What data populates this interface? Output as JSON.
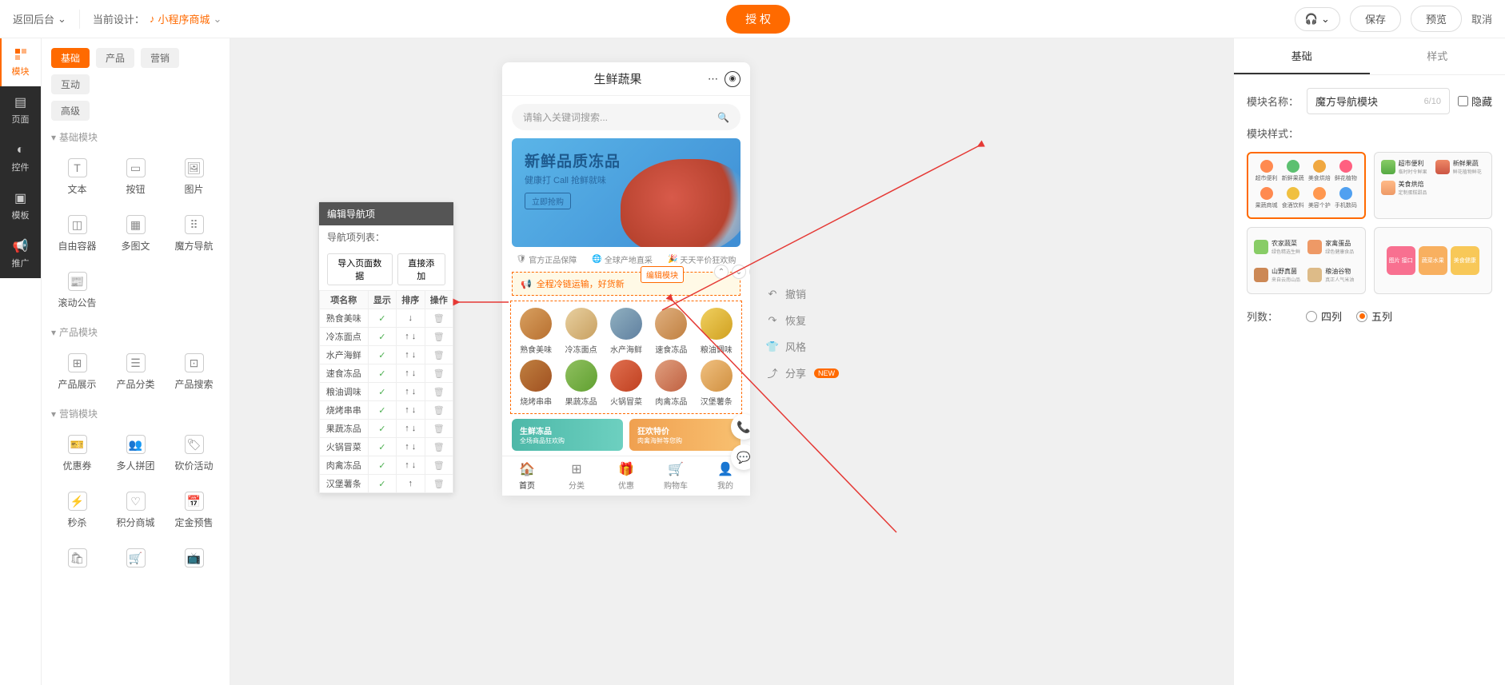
{
  "topbar": {
    "back": "返回后台",
    "current_design_label": "当前设计：",
    "current_design_name": "小程序商城",
    "auth": "授 权",
    "save": "保存",
    "preview": "预览",
    "cancel": "取消"
  },
  "nav_rail": [
    {
      "label": "模块",
      "active": true
    },
    {
      "label": "页面",
      "active": false
    },
    {
      "label": "控件",
      "active": false
    },
    {
      "label": "模板",
      "active": false
    },
    {
      "label": "推广",
      "active": false
    }
  ],
  "palette": {
    "tabs_row1": [
      {
        "label": "基础",
        "active": true
      },
      {
        "label": "产品",
        "active": false
      },
      {
        "label": "营销",
        "active": false
      },
      {
        "label": "互动",
        "active": false
      }
    ],
    "tabs_row2": [
      {
        "label": "高级",
        "active": false
      }
    ],
    "sections": [
      {
        "title": "基础模块",
        "items": [
          "文本",
          "按钮",
          "图片",
          "自由容器",
          "多图文",
          "魔方导航",
          "滚动公告"
        ]
      },
      {
        "title": "产品模块",
        "items": [
          "产品展示",
          "产品分类",
          "产品搜索"
        ]
      },
      {
        "title": "营销模块",
        "items": [
          "优惠券",
          "多人拼团",
          "砍价活动",
          "秒杀",
          "积分商城",
          "定金预售"
        ]
      }
    ]
  },
  "nav_panel": {
    "title": "编辑导航项",
    "subtitle": "导航项列表：",
    "btn_import": "导入页面数据",
    "btn_add": "直接添加",
    "headers": [
      "项名称",
      "显示",
      "排序",
      "操作"
    ],
    "rows": [
      {
        "name": "熟食美味",
        "show": true,
        "sort": "down"
      },
      {
        "name": "冷冻面点",
        "show": true,
        "sort": "both"
      },
      {
        "name": "水产海鲜",
        "show": true,
        "sort": "both"
      },
      {
        "name": "速食冻品",
        "show": true,
        "sort": "both"
      },
      {
        "name": "粮油调味",
        "show": true,
        "sort": "both"
      },
      {
        "name": "烧烤串串",
        "show": true,
        "sort": "both"
      },
      {
        "name": "果蔬冻品",
        "show": true,
        "sort": "both"
      },
      {
        "name": "火锅冒菜",
        "show": true,
        "sort": "both"
      },
      {
        "name": "肉禽冻品",
        "show": true,
        "sort": "both"
      },
      {
        "name": "汉堡薯条",
        "show": true,
        "sort": "up"
      }
    ]
  },
  "phone": {
    "title": "生鲜蔬果",
    "search_placeholder": "请输入关键词搜索...",
    "banner": {
      "title": "新鲜品质冻品",
      "sub": "健康打 Call 抢鲜就味",
      "btn": "立即抢购"
    },
    "bar": [
      "官方正品保障",
      "全球产地直采",
      "天天平价狂欢购"
    ],
    "notice": "全程冷链运输，好货新",
    "edit_badge": "编辑模块",
    "navgrid": [
      "熟食美味",
      "冷冻面点",
      "水产海鲜",
      "速食冻品",
      "粮油调味",
      "烧烤串串",
      "果蔬冻品",
      "火锅冒菜",
      "肉禽冻品",
      "汉堡薯条"
    ],
    "promo": [
      {
        "t1": "生鲜冻品",
        "t2": "全场商品狂欢购"
      },
      {
        "t1": "狂欢特价",
        "t2": "肉禽海鲜等您购"
      }
    ],
    "tabbar": [
      {
        "label": "首页",
        "active": true
      },
      {
        "label": "分类",
        "active": false
      },
      {
        "label": "优惠",
        "active": false
      },
      {
        "label": "购物车",
        "active": false
      },
      {
        "label": "我的",
        "active": false
      }
    ]
  },
  "ctx": {
    "undo": "撤销",
    "redo": "恢复",
    "style": "风格",
    "share": "分享",
    "new": "NEW"
  },
  "props": {
    "tab_basic": "基础",
    "tab_style": "样式",
    "name_label": "模块名称：",
    "name_value": "魔方导航模块",
    "name_count": "6/10",
    "hide_label": "隐藏",
    "style_label": "模块样式：",
    "cols_label": "列数：",
    "cols_4": "四列",
    "cols_5": "五列",
    "preset_a": [
      "超市便利",
      "新鲜果蔬",
      "美食烘焙",
      "鲜花植物",
      "果蔬商城",
      "食酒饮料",
      "美容个护",
      "手机数码"
    ],
    "preset_b": [
      "超市便利",
      "临时时令鲜果",
      "新鲜果蔬",
      "鲜花植物鲜花",
      "美食烘焙",
      "定制蛋糕甜品"
    ],
    "preset_c": [
      "农家蔬菜",
      "绿色精选生鲜",
      "家禽蛋品",
      "绿色健康食品",
      "山野真菌",
      "来自云南山品",
      "粮油谷物",
      "真正人气米油"
    ],
    "preset_d": [
      "图片 接口",
      "蔬菜水果",
      "美食健康"
    ]
  }
}
